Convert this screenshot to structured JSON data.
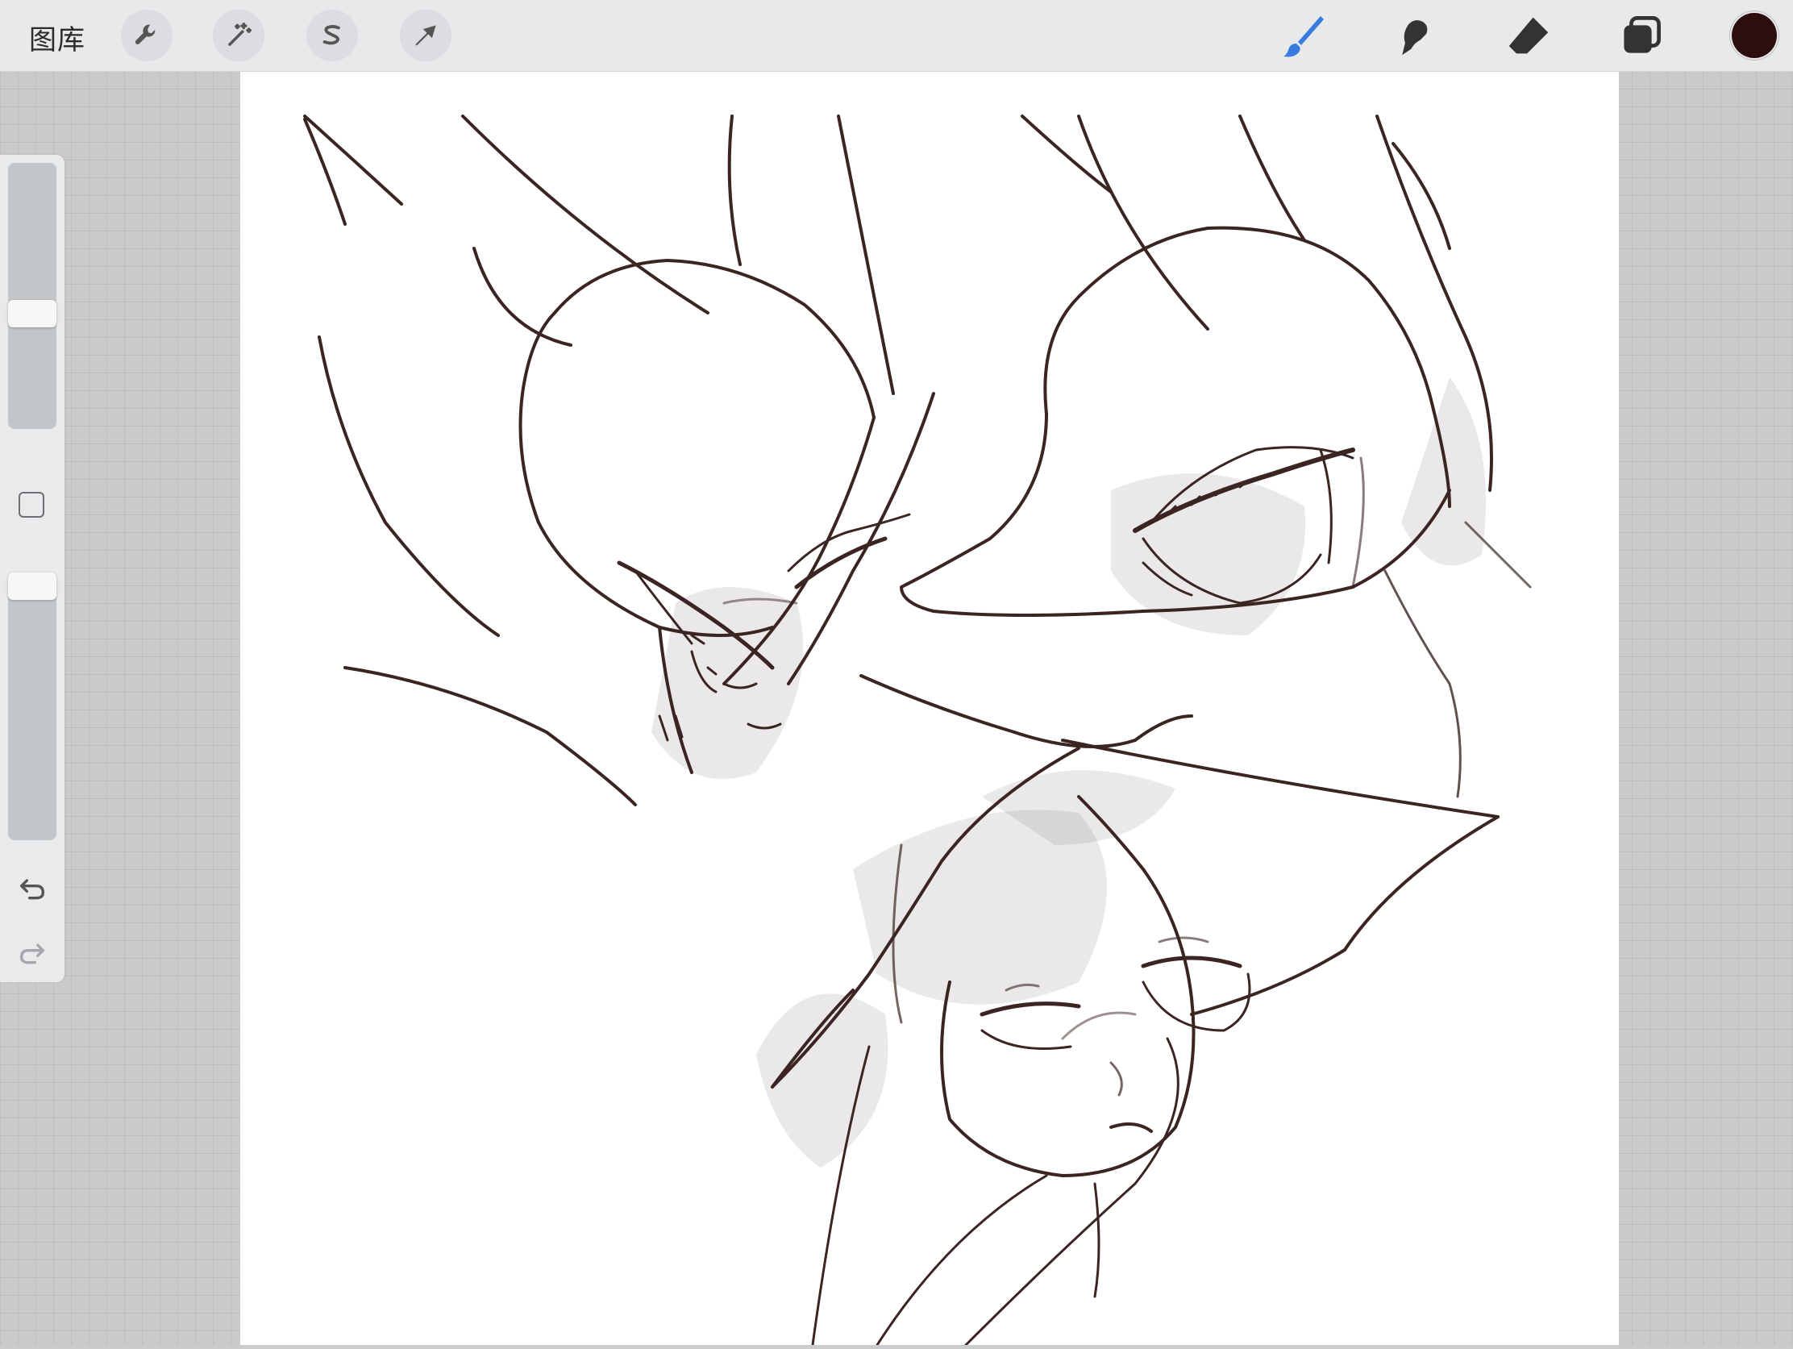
{
  "toolbar": {
    "gallery_label": "图库",
    "left_tools": [
      {
        "name": "actions",
        "icon": "wrench-icon"
      },
      {
        "name": "adjustments",
        "icon": "magic-wand-icon"
      },
      {
        "name": "selection",
        "icon": "selection-s-icon"
      },
      {
        "name": "transform",
        "icon": "arrow-cursor-icon"
      }
    ],
    "right_tools": [
      {
        "name": "brush",
        "icon": "brush-icon",
        "active": true
      },
      {
        "name": "smudge",
        "icon": "smudge-icon"
      },
      {
        "name": "eraser",
        "icon": "eraser-icon"
      },
      {
        "name": "layers",
        "icon": "layers-icon"
      }
    ],
    "active_tool_color": "#3a7be0",
    "current_color": "#2c0f0c"
  },
  "sidebar": {
    "brush_size_level": 0.55,
    "opacity_level": 0.95,
    "modify_button_icon": "square-icon",
    "undo_icon": "undo-icon",
    "redo_icon": "redo-icon"
  },
  "canvas": {
    "background": "#ffffff",
    "ink_color": "#3b2522",
    "content": "sketch"
  }
}
